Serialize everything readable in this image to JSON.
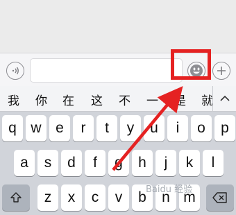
{
  "candidates": [
    "我",
    "你",
    "在",
    "这",
    "不",
    "一",
    "是",
    "就"
  ],
  "keyboard": {
    "row1": [
      "q",
      "w",
      "e",
      "r",
      "t",
      "y",
      "u",
      "i",
      "o",
      "p"
    ],
    "row2": [
      "a",
      "s",
      "d",
      "f",
      "g",
      "h",
      "j",
      "k",
      "l"
    ],
    "row3": [
      "z",
      "x",
      "c",
      "v",
      "b",
      "n",
      "m"
    ]
  },
  "watermark": "Baidu 经验",
  "icons": {
    "voice": "voice-icon",
    "emoji": "emoji-icon",
    "plus": "plus-icon",
    "shift": "shift-icon",
    "delete": "delete-icon",
    "collapse": "chevron-up-icon"
  },
  "colors": {
    "annotation": "#e52222",
    "keyboard_bg": "#d1d4da"
  }
}
